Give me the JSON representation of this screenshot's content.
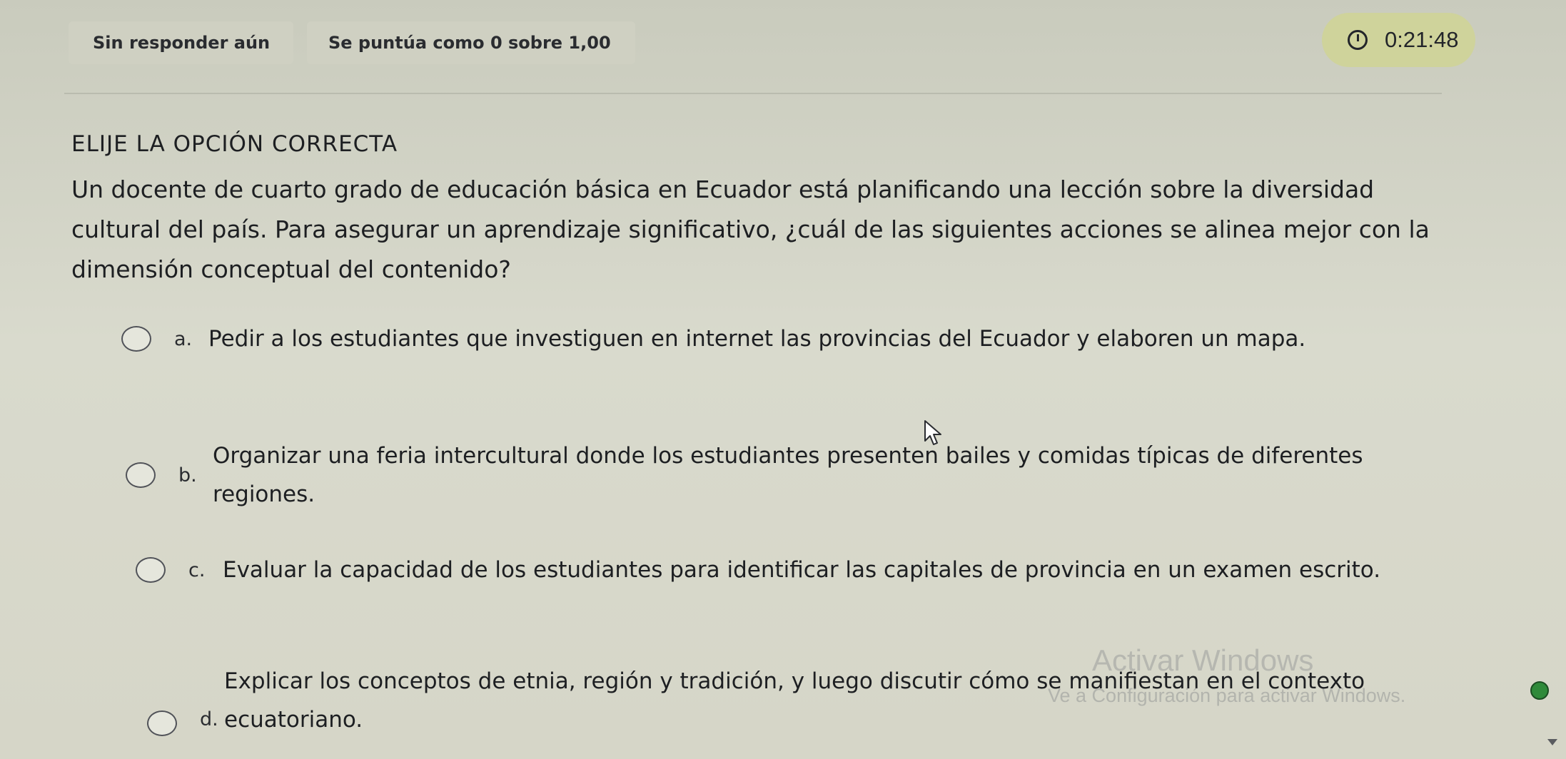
{
  "header": {
    "status": "Sin responder aún",
    "score": "Se puntúa como 0 sobre 1,00",
    "timer": "0:21:48",
    "timer_icon": "clock-icon"
  },
  "question": {
    "instruction": "ELIJE LA OPCIÓN CORRECTA",
    "text": "Un docente de cuarto grado de educación básica en Ecuador está planificando una lección sobre la diversidad cultural del país. Para asegurar un aprendizaje significativo, ¿cuál de las siguientes acciones se alinea mejor con la dimensión conceptual del contenido?"
  },
  "options": [
    {
      "letter": "a.",
      "text": "Pedir a los estudiantes que investiguen en internet las provincias del Ecuador y elaboren un mapa."
    },
    {
      "letter": "b.",
      "text": "Organizar una feria intercultural donde los estudiantes presenten bailes y comidas típicas de diferentes regiones."
    },
    {
      "letter": "c.",
      "text": "Evaluar la capacidad de los estudiantes para identificar las capitales de provincia en un examen escrito."
    },
    {
      "letter": "d.",
      "text": "Explicar los conceptos de etnia, región y tradición, y luego discutir cómo se manifiestan en el contexto ecuatoriano."
    }
  ],
  "watermark": {
    "title": "Activar Windows",
    "subtitle": "Ve a Configuración para activar Windows."
  },
  "colors": {
    "background": "#d3d4c6",
    "timer_pill": "#cfd39b",
    "text": "#1d1f22"
  }
}
